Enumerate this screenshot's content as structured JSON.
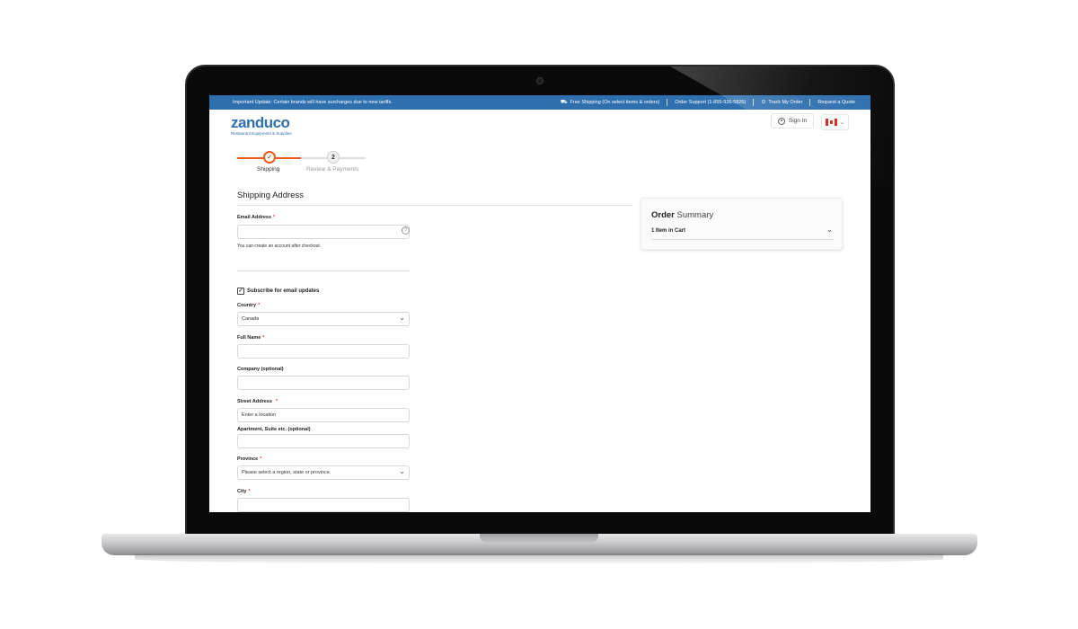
{
  "topbar": {
    "announcement": "Important Update: Certain brands will have surcharges due to new tariffs.",
    "free_shipping": "Free Shipping (On select items & orders)",
    "support": "Order Support (1-855-926-5826)",
    "track": "Track My Order",
    "quote": "Request a Quote",
    "color": "#2f6fae"
  },
  "header": {
    "logo": "zanduco",
    "tagline": "Restaurant Equipment & Supplies",
    "sign_in": "Sign In",
    "country_flag": "canada-flag"
  },
  "steps": {
    "items": [
      {
        "label": "Shipping",
        "state": "done"
      },
      {
        "label": "Review & Payments",
        "number": "2"
      }
    ],
    "accent": "#ef5b1f"
  },
  "form": {
    "title": "Shipping Address",
    "email_label": "Email Address",
    "email_value": "",
    "email_hint": "You can create an account after checkout.",
    "subscribe_label": "Subscribe for email updates",
    "subscribe_checked": true,
    "country_label": "Country",
    "country_value": "Canada",
    "fullname_label": "Full Name",
    "company_label": "Company (optional)",
    "street_label": "Street Address",
    "street_placeholder": "Enter a location",
    "apartment_label": "Apartment, Suite etc. (optional)",
    "province_label": "Province",
    "province_value": "Please select a region, state or province.",
    "city_label": "City",
    "required_mark": "*"
  },
  "summary": {
    "title_bold": "Order",
    "title_light": "Summary",
    "items_text": "1 Item in Cart"
  }
}
